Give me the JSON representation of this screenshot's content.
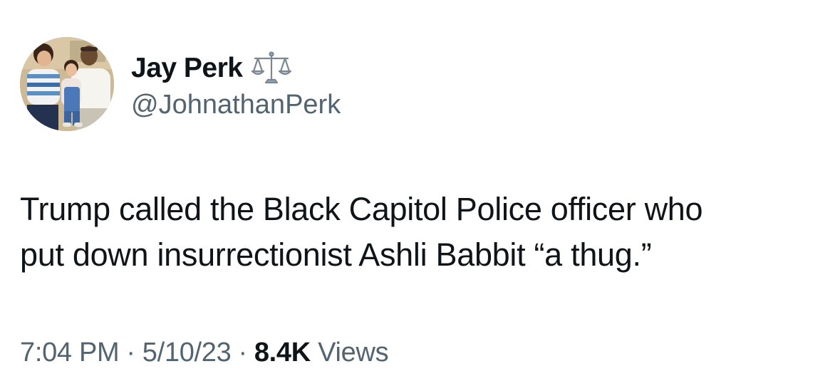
{
  "author": {
    "display_name": "Jay Perk",
    "handle": "@JohnathanPerk",
    "badge_icon": "balance-scale-icon"
  },
  "tweet": {
    "text_line_1": "Trump called the Black Capitol Police officer who",
    "text_line_2": "put down insurrectionist Ashli Babbit “a thug.”"
  },
  "meta": {
    "time": "7:04 PM",
    "date": "5/10/23",
    "separator": "·",
    "views_count": "8.4K",
    "views_label": "Views"
  },
  "colors": {
    "primary_text": "#0f1419",
    "secondary_text": "#536471",
    "background": "#ffffff"
  }
}
